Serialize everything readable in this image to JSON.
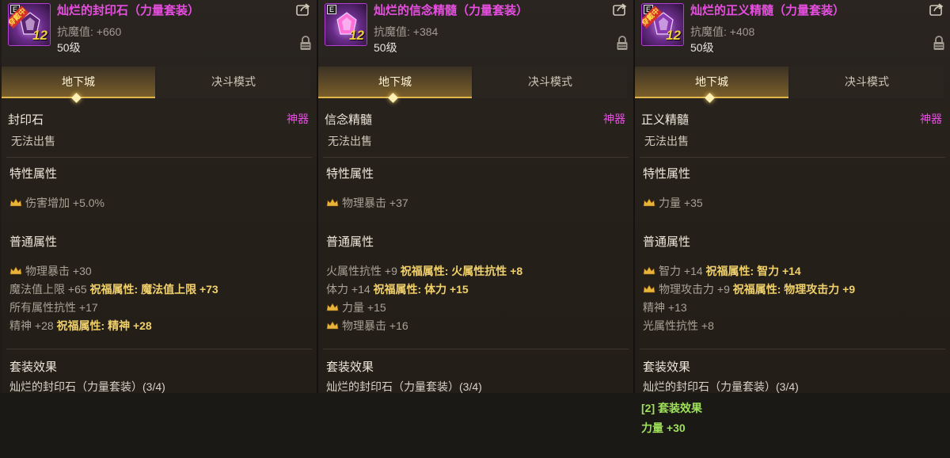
{
  "tabs": {
    "dungeon": "地下城",
    "duel": "决斗模式"
  },
  "panels": [
    {
      "name": "灿烂的封印石（力量套装）",
      "rank_letter": "E",
      "worn_badge": "穿戴中",
      "level_badge": "12",
      "resist": "抗魔值: +660",
      "level": "50级",
      "type": "封印石",
      "grade": "神器",
      "nosell": "无法出售",
      "special_title": "特性属性",
      "special": [
        {
          "crown": true,
          "text": "伤害增加 +5.0%"
        }
      ],
      "normal_title": "普通属性",
      "normal": [
        {
          "crown": true,
          "text": "物理暴击 +30",
          "bless": ""
        },
        {
          "crown": false,
          "text": "魔法值上限 +65",
          "bless": "祝福属性:  魔法值上限 +73"
        },
        {
          "crown": false,
          "text": "所有属性抗性 +17",
          "bless": ""
        },
        {
          "crown": false,
          "text": "精神 +28",
          "bless": "祝福属性:  精神 +28"
        }
      ],
      "set_title": "套装效果",
      "set_name": "灿烂的封印石（力量套装）(3/4)"
    },
    {
      "name": "灿烂的信念精髓（力量套装）",
      "rank_letter": "E",
      "worn_badge": "",
      "level_badge": "12",
      "resist": "抗魔值: +384",
      "level": "50级",
      "type": "信念精髓",
      "grade": "神器",
      "nosell": "无法出售",
      "special_title": "特性属性",
      "special": [
        {
          "crown": true,
          "text": "物理暴击 +37"
        }
      ],
      "normal_title": "普通属性",
      "normal": [
        {
          "crown": false,
          "text": "火属性抗性 +9",
          "bless": "祝福属性:  火属性抗性 +8"
        },
        {
          "crown": false,
          "text": "体力 +14",
          "bless": "祝福属性:  体力 +15"
        },
        {
          "crown": true,
          "text": "力量 +15",
          "bless": ""
        },
        {
          "crown": true,
          "text": "物理暴击 +16",
          "bless": ""
        }
      ],
      "set_title": "套装效果",
      "set_name": "灿烂的封印石（力量套装）(3/4)"
    },
    {
      "name": "灿烂的正义精髓（力量套装）",
      "rank_letter": "E",
      "worn_badge": "穿戴中",
      "level_badge": "12",
      "resist": "抗魔值: +408",
      "level": "50级",
      "type": "正义精髓",
      "grade": "神器",
      "nosell": "无法出售",
      "special_title": "特性属性",
      "special": [
        {
          "crown": true,
          "text": "力量 +35"
        }
      ],
      "normal_title": "普通属性",
      "normal": [
        {
          "crown": true,
          "text": "智力 +14",
          "bless": "祝福属性:  智力 +14"
        },
        {
          "crown": true,
          "text": "物理攻击力 +9",
          "bless": "祝福属性:  物理攻击力 +9"
        },
        {
          "crown": false,
          "text": "精神 +13",
          "bless": ""
        },
        {
          "crown": false,
          "text": "光属性抗性 +8",
          "bless": ""
        }
      ],
      "set_title": "套装效果",
      "set_name": "灿烂的封印石（力量套装）(3/4)"
    }
  ],
  "tail": {
    "set_effect": "[2] 套装效果",
    "bonus": "力量 +30"
  },
  "colors": {
    "legendary": "#e64ee0",
    "bless": "#f0d06a",
    "set_bonus": "#9ee05a",
    "tab_gold": "#e0b64a"
  }
}
